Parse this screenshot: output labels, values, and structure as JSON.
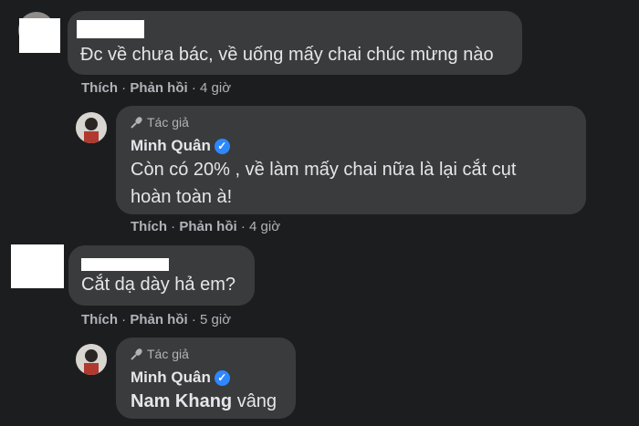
{
  "comments": [
    {
      "author": "",
      "text": "Đc về chưa bác, về uống mấy chai chúc mừng nào",
      "like": "Thích",
      "reply": "Phản hồi",
      "time": "4 giờ"
    },
    {
      "badge": "Tác giả",
      "author": "Minh Quân",
      "text_line1": "Còn có 20% , về làm mấy chai nữa là lại cắt cụt",
      "text_line2": "hoàn toàn à!",
      "like": "Thích",
      "reply": "Phản hồi",
      "time": "4 giờ"
    },
    {
      "author": "",
      "text": "Cắt dạ dày hả em?",
      "like": "Thích",
      "reply": "Phản hồi",
      "time": "5 giờ"
    },
    {
      "badge": "Tác giả",
      "author": "Minh Quân",
      "mention": "Nam Khang",
      "text": "vâng"
    }
  ],
  "separator": "·",
  "icons": {
    "verified": "verified-badge-icon",
    "author": "microphone-icon"
  },
  "colors": {
    "background": "#1c1d1f",
    "bubble": "#3a3b3c",
    "verified": "#2d88ff"
  }
}
